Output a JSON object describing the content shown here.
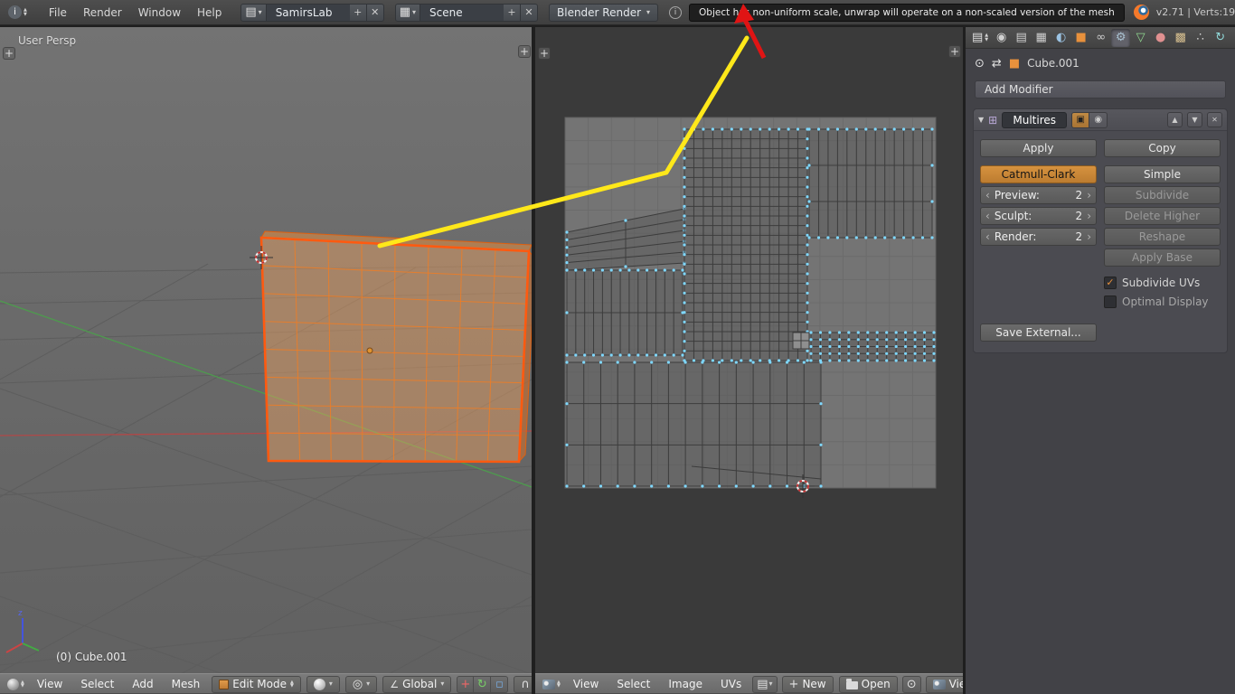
{
  "topbar": {
    "menus": [
      "File",
      "Render",
      "Window",
      "Help"
    ],
    "screen_layout": "SamirsLab",
    "scene": "Scene",
    "engine": "Blender Render",
    "status_message": "Object has non-uniform scale, unwrap will operate on a non-scaled version of the mesh",
    "version_text": "v2.71 | Verts:19"
  },
  "viewport3d": {
    "view_label": "User Persp",
    "object_info": "(0) Cube.001",
    "header": {
      "menus": [
        "View",
        "Select",
        "Add",
        "Mesh"
      ],
      "mode": "Edit Mode",
      "orientation": "Global"
    }
  },
  "uv_editor": {
    "header": {
      "menus": [
        "View",
        "Select",
        "Image",
        "UVs"
      ],
      "new_label": "New",
      "open_label": "Open",
      "view_label": "View"
    }
  },
  "properties": {
    "breadcrumb_object": "Cube.001",
    "add_modifier_label": "Add Modifier",
    "modifier": {
      "name": "Multires",
      "apply_label": "Apply",
      "copy_label": "Copy",
      "subdivision_type_active": "Catmull-Clark",
      "subdivision_type_inactive": "Simple",
      "preview_label": "Preview:",
      "preview_value": "2",
      "sculpt_label": "Sculpt:",
      "sculpt_value": "2",
      "render_label": "Render:",
      "render_value": "2",
      "subdivide_label": "Subdivide",
      "delete_higher_label": "Delete Higher",
      "reshape_label": "Reshape",
      "apply_base_label": "Apply Base",
      "subdivide_uvs_label": "Subdivide UVs",
      "optimal_display_label": "Optimal Display",
      "save_external_label": "Save External..."
    }
  },
  "colors": {
    "accent_orange": "#e8913c",
    "selection_orange": "#ff5a10",
    "uv_vertex_cyan": "#7fd8ff",
    "annotation_yellow": "#ffe81a",
    "annotation_red": "#e01414"
  }
}
